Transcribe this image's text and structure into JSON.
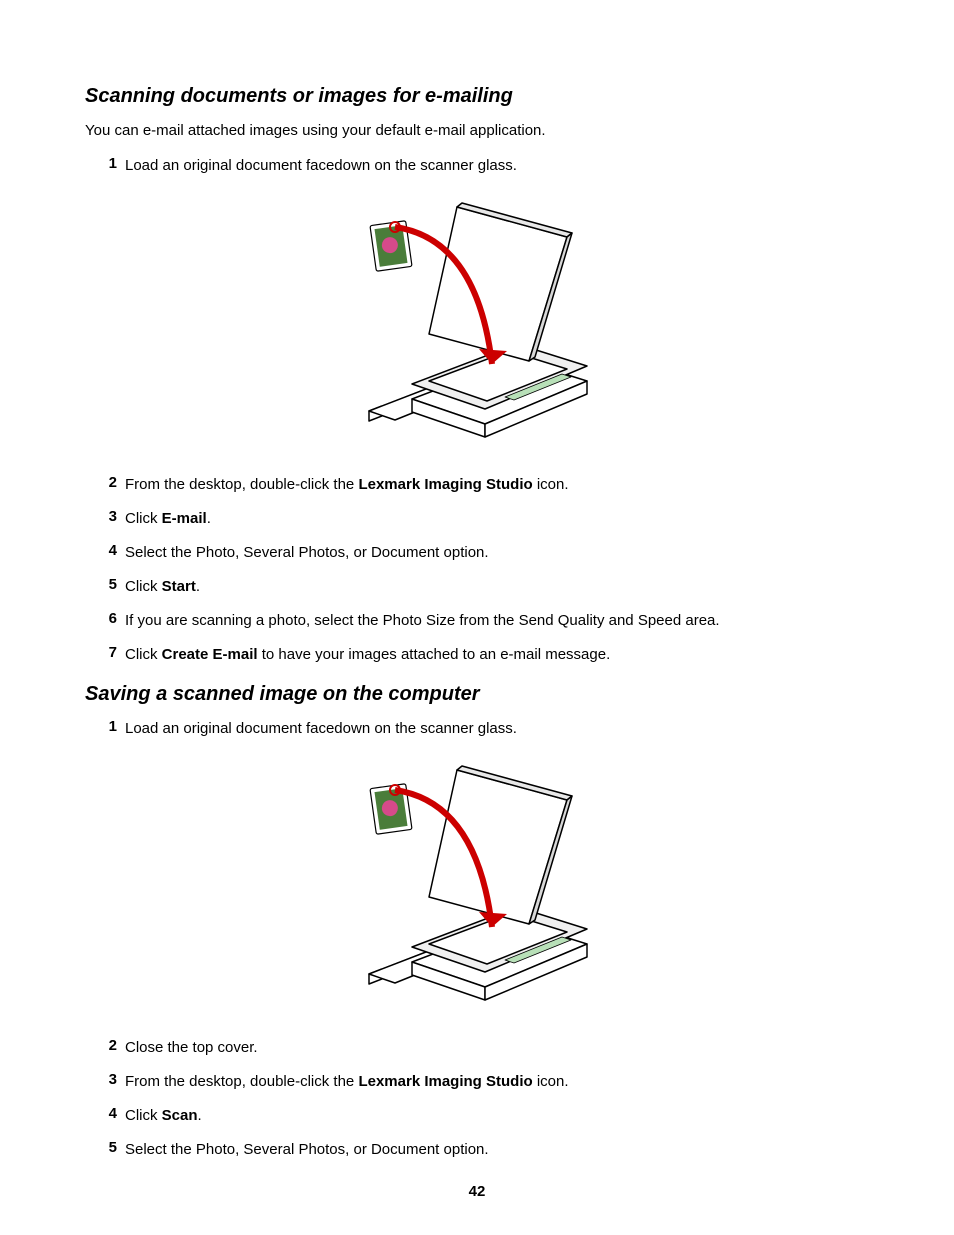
{
  "section1": {
    "heading": "Scanning documents or images for e-mailing",
    "intro": "You can e-mail attached images using your default e-mail application.",
    "steps": [
      {
        "num": "1",
        "parts": [
          {
            "t": "Load an original document facedown on the scanner glass."
          }
        ]
      },
      {
        "num": "2",
        "parts": [
          {
            "t": "From the desktop, double-click the "
          },
          {
            "t": "Lexmark Imaging Studio",
            "b": true
          },
          {
            "t": " icon."
          }
        ]
      },
      {
        "num": "3",
        "parts": [
          {
            "t": "Click "
          },
          {
            "t": "E-mail",
            "b": true
          },
          {
            "t": "."
          }
        ]
      },
      {
        "num": "4",
        "parts": [
          {
            "t": "Select the Photo, Several Photos, or Document option."
          }
        ]
      },
      {
        "num": "5",
        "parts": [
          {
            "t": "Click "
          },
          {
            "t": "Start",
            "b": true
          },
          {
            "t": "."
          }
        ]
      },
      {
        "num": "6",
        "parts": [
          {
            "t": "If you are scanning a photo, select the Photo Size from the Send Quality and Speed area."
          }
        ]
      },
      {
        "num": "7",
        "parts": [
          {
            "t": "Click "
          },
          {
            "t": "Create E-mail",
            "b": true
          },
          {
            "t": " to have your images attached to an e-mail message."
          }
        ]
      }
    ]
  },
  "section2": {
    "heading": "Saving a scanned image on the computer",
    "steps": [
      {
        "num": "1",
        "parts": [
          {
            "t": "Load an original document facedown on the scanner glass."
          }
        ]
      },
      {
        "num": "2",
        "parts": [
          {
            "t": "Close the top cover."
          }
        ]
      },
      {
        "num": "3",
        "parts": [
          {
            "t": "From the desktop, double-click the "
          },
          {
            "t": "Lexmark Imaging Studio",
            "b": true
          },
          {
            "t": " icon."
          }
        ]
      },
      {
        "num": "4",
        "parts": [
          {
            "t": "Click "
          },
          {
            "t": "Scan",
            "b": true
          },
          {
            "t": "."
          }
        ]
      },
      {
        "num": "5",
        "parts": [
          {
            "t": "Select the Photo, Several Photos, or Document option."
          }
        ]
      }
    ]
  },
  "pageNumber": "42"
}
